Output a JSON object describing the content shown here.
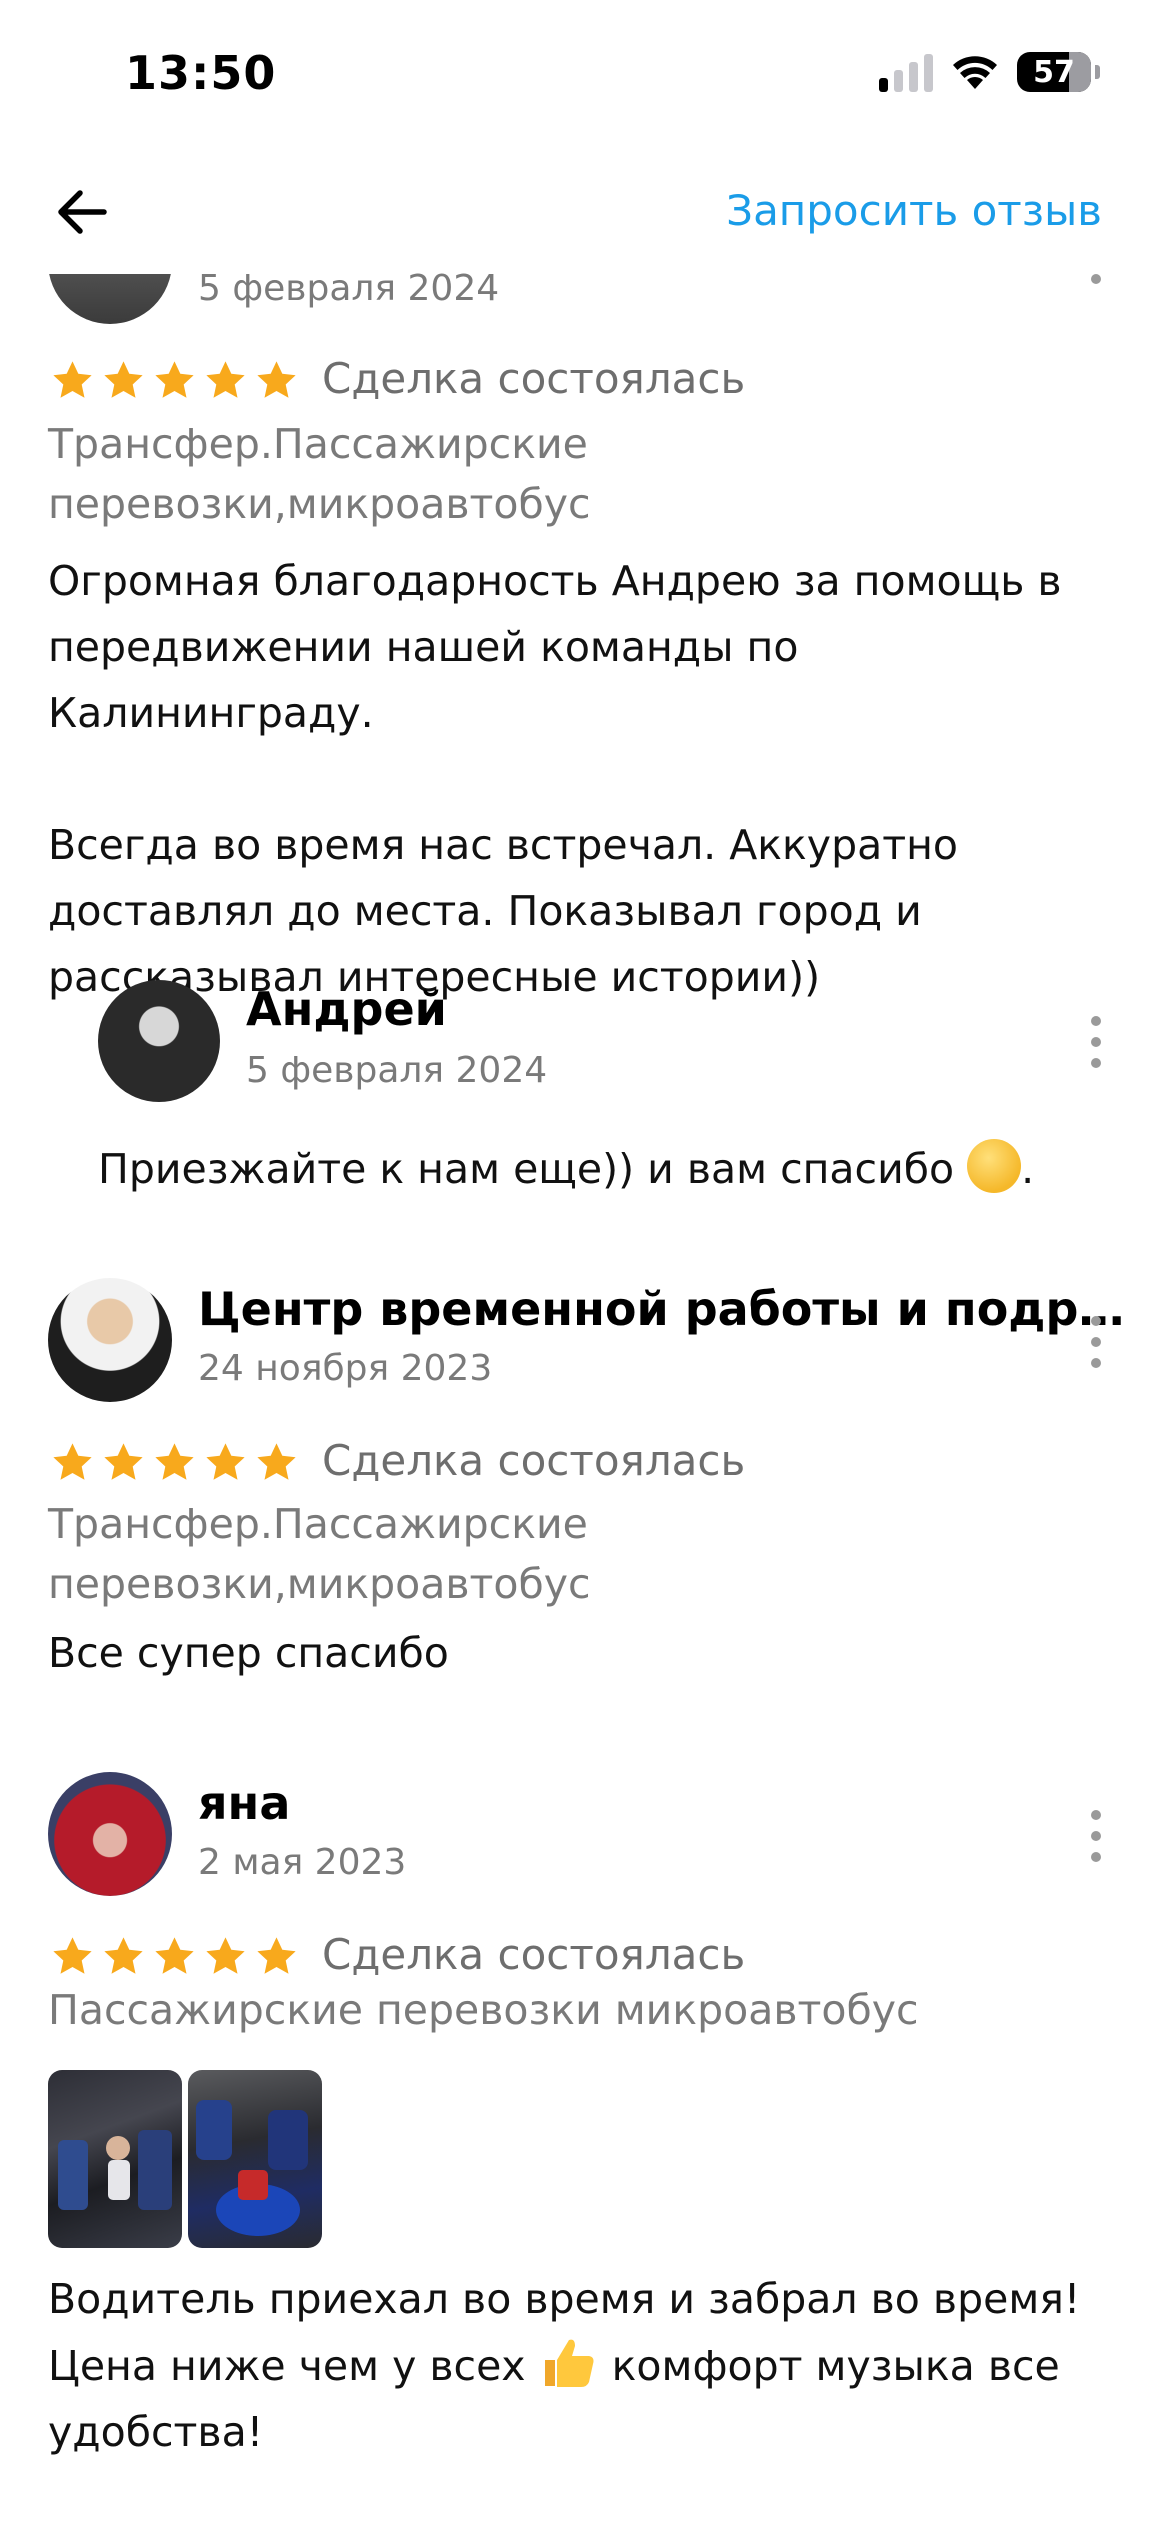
{
  "status": {
    "time": "13:50",
    "battery": "57"
  },
  "nav": {
    "request_label": "Запросить отзыв"
  },
  "reviews": [
    {
      "date": "5 февраля 2024",
      "deal": "Сделка состоялась",
      "category": "Трансфер.Пассажирские\nперевозки,микроавтобус",
      "text": "Огромная благодарность Андрею за помощь в\nпередвижении нашей команды  по Калининграду.\n\nВсегда во время нас встречал. Аккуратно\nдоставлял до места.  Показывал город и\nрассказывал интересные истории))",
      "reply": {
        "name": "Андрей",
        "date": "5 февраля 2024",
        "text": "Приезжайте к нам еще)) и вам спасибо"
      }
    },
    {
      "name": "Центр временной работы и подр…",
      "date": "24 ноября 2023",
      "deal": "Сделка состоялась",
      "category": "Трансфер.Пассажирские\nперевозки,микроавтобус",
      "text": "Все супер спасибо"
    },
    {
      "name": "яна",
      "date": "2 мая 2023",
      "deal": "Сделка состоялась",
      "category": "Пассажирские перевозки микроавтобус",
      "text_line1": "Водитель приехал во время и забрал во время!",
      "text_line2a": "Цена ниже чем у всех",
      "text_line2b": "комфорт музыка все",
      "text_line3": "удобства!"
    }
  ],
  "colors": {
    "accent": "#1a9ce8",
    "star": "#f8a91c"
  }
}
